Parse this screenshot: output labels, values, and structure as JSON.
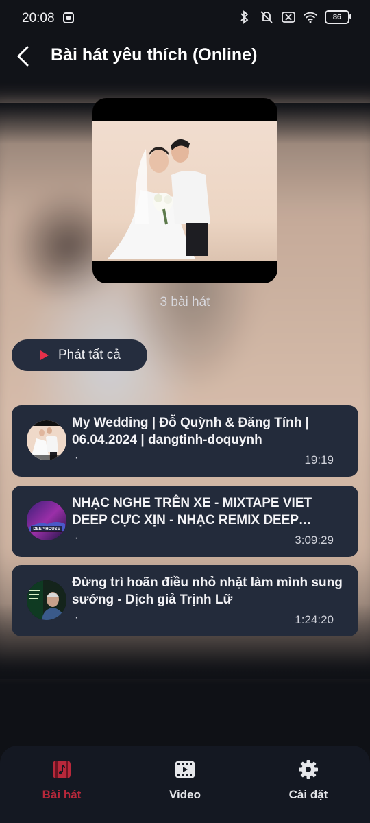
{
  "status_bar": {
    "time": "20:08",
    "battery": "86",
    "icons": [
      "app-notification-icon",
      "bluetooth-icon",
      "mute-icon",
      "sim-off-icon",
      "wifi-icon",
      "battery-icon"
    ]
  },
  "header": {
    "title": "Bài hát yêu thích (Online)",
    "back_icon": "back-arrow-icon"
  },
  "playlist": {
    "song_count": "3 bài hát",
    "play_all_label": "Phát tất cả"
  },
  "songs": [
    {
      "title": "My Wedding | Đỗ Quỳnh & Đăng Tính | 06.04.2024 | dangtinh-doquynh",
      "subtitle": "·",
      "duration": "19:19",
      "thumbnail": "wedding-thumbnail"
    },
    {
      "title": "NHẠC NGHE TRÊN XE - MIXTAPE VIET DEEP CỰC XỊN - NHẠC REMIX DEEP HOUSE",
      "subtitle": "·",
      "duration": "3:09:29",
      "thumbnail": "deep-house-thumbnail",
      "thumb_text": "DEEP HOUSE"
    },
    {
      "title": "Đừng trì hoãn điều nhỏ nhặt làm mình sung sướng - Dịch giả Trịnh Lữ",
      "subtitle": "·",
      "duration": "1:24:20",
      "thumbnail": "talk-thumbnail"
    }
  ],
  "bottom_nav": {
    "items": [
      {
        "label": "Bài hát",
        "icon": "music-note-icon",
        "active": true
      },
      {
        "label": "Video",
        "icon": "video-icon",
        "active": false
      },
      {
        "label": "Cài đặt",
        "icon": "settings-gear-icon",
        "active": false
      }
    ]
  },
  "colors": {
    "background": "#0f1116",
    "card": "#232b3b",
    "play_button": "#252d3e",
    "accent": "#e7304a",
    "active_nav": "#b8283b"
  }
}
